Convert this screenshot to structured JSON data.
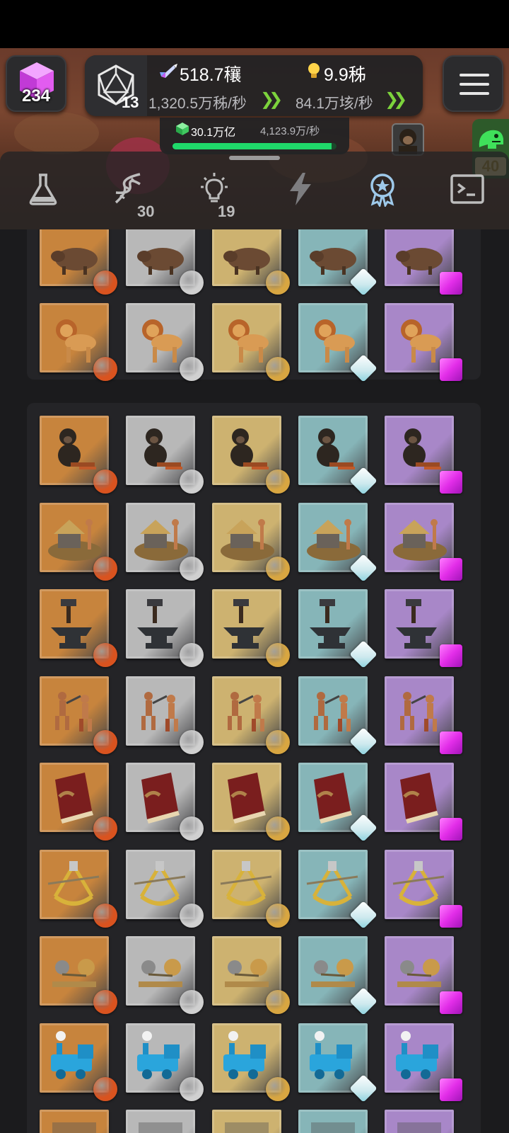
{
  "header": {
    "gems": "234",
    "dice_level": "13",
    "resource_a": {
      "value": "518.7穰",
      "rate": "1,320.5万秭/秒",
      "icon": "rocket-icon"
    },
    "resource_b": {
      "value": "9.9秭",
      "rate": "84.1万垓/秒",
      "icon": "lightbulb-icon"
    },
    "dna": {
      "value": "30.1万亿",
      "rate": "4,123.9万/秒",
      "progress": 0.97
    },
    "side_badge": "40"
  },
  "tabs": [
    {
      "name": "lab",
      "count": ""
    },
    {
      "name": "dna",
      "count": "30"
    },
    {
      "name": "ideas",
      "count": "19"
    },
    {
      "name": "energy",
      "count": ""
    },
    {
      "name": "achievements",
      "count": "",
      "active": true
    },
    {
      "name": "console",
      "count": ""
    }
  ],
  "tiers": [
    {
      "name": "bronze",
      "bg": "#c7843d",
      "badge": "#d9531f"
    },
    {
      "name": "silver",
      "bg": "#b8b8b8",
      "badge": "#d0d0d0"
    },
    {
      "name": "gold",
      "bg": "#cdb270",
      "badge": "#d8a641"
    },
    {
      "name": "diamond",
      "bg": "#86b5b8",
      "badge": "#cde9ee"
    },
    {
      "name": "amethyst",
      "bg": "#a887c8",
      "badge": "#e22de8"
    }
  ],
  "panel1_rows": [
    "boar",
    "lion"
  ],
  "panel2_rows": [
    "chimp",
    "hut",
    "anvil",
    "fighters",
    "book",
    "sextant",
    "steam-engine",
    "locomotive",
    "next"
  ]
}
